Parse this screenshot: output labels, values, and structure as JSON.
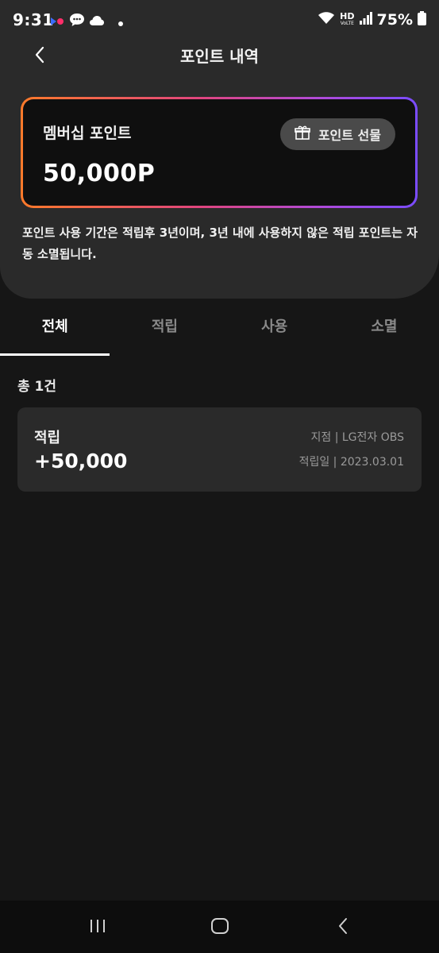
{
  "status_bar": {
    "time": "9:31",
    "network_label": "HD",
    "battery_percent": "75%",
    "icons": [
      "app-dots-icon",
      "chat-bubble-icon",
      "cloud-icon",
      "dot-icon",
      "wifi-icon",
      "hd-voice-icon",
      "signal-icon",
      "battery-icon"
    ]
  },
  "header": {
    "title": "포인트 내역",
    "back_icon": "chevron-left-icon"
  },
  "membership_card": {
    "label": "멤버십 포인트",
    "points": "50,000P",
    "gift_button_label": "포인트 선물",
    "gift_icon": "gift-icon",
    "gradient_colors": [
      "#ff7a2a",
      "#e0457e",
      "#b04ad8",
      "#7a4cff"
    ]
  },
  "notice": "포인트 사용 기간은 적립후 3년이며, 3년 내에 사용하지 않은 적립 포인트는 자동 소멸됩니다.",
  "tabs": [
    {
      "label": "전체",
      "active": true
    },
    {
      "label": "적립",
      "active": false
    },
    {
      "label": "사용",
      "active": false
    },
    {
      "label": "소멸",
      "active": false
    }
  ],
  "total_count": "총 1건",
  "history": [
    {
      "type": "적립",
      "amount": "+50,000",
      "branch": "지점 | LG전자 OBS",
      "date": "적립일 | 2023.03.01"
    }
  ],
  "system_nav": {
    "icons": [
      "recent-apps-icon",
      "home-icon",
      "back-icon"
    ]
  }
}
